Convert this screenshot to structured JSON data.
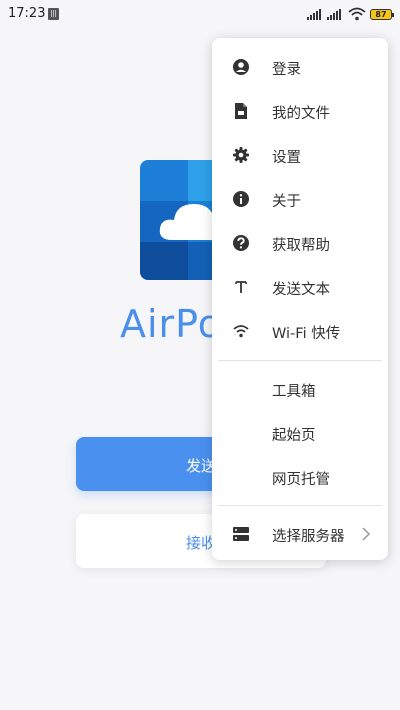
{
  "status_bar": {
    "time": "17:23",
    "battery": "87"
  },
  "app": {
    "name": "AirPo",
    "send_button": "发送",
    "receive_button": "接收"
  },
  "menu": {
    "items": [
      {
        "label": "登录",
        "icon": "account-circle-icon"
      },
      {
        "label": "我的文件",
        "icon": "file-icon"
      },
      {
        "label": "设置",
        "icon": "gear-icon"
      },
      {
        "label": "关于",
        "icon": "info-icon"
      },
      {
        "label": "获取帮助",
        "icon": "help-icon"
      },
      {
        "label": "发送文本",
        "icon": "text-icon"
      },
      {
        "label": "Wi-Fi 快传",
        "icon": "wifi-icon"
      }
    ],
    "extra_items": [
      {
        "label": "工具箱"
      },
      {
        "label": "起始页"
      },
      {
        "label": "网页托管"
      }
    ],
    "server_item": {
      "label": "选择服务器",
      "icon": "server-icon"
    }
  },
  "colors": {
    "accent": "#4a90ee",
    "background": "#f6f6f8"
  }
}
